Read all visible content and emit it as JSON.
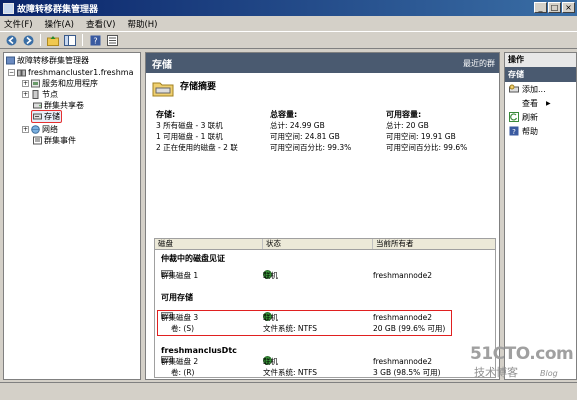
{
  "window": {
    "title": "故障转移群集管理器"
  },
  "menu": [
    "文件(F)",
    "操作(A)",
    "查看(V)",
    "帮助(H)"
  ],
  "tree": {
    "root": "故障转移群集管理器",
    "cluster": "freshmancluster1.freshma",
    "items": [
      "服务和应用程序",
      "节点",
      "群集共享卷",
      "存储",
      "网络",
      "群集事件"
    ]
  },
  "center": {
    "header": "存储",
    "recent": "最近的群",
    "summary_title": "存储摘要",
    "storage_col": {
      "heading": "存储:",
      "lines": [
        "3 所有磁盘 - 3 联机",
        "1 可用磁盘 - 1 联机",
        "2 正在使用的磁盘 - 2 联"
      ]
    },
    "total_col": {
      "heading": "总容量:",
      "lines": [
        "总计: 24.99 GB",
        "可用空间: 24.81 GB",
        "可用空间百分比: 99.3%"
      ]
    },
    "avail_col": {
      "heading": "可用容量:",
      "lines": [
        "总计: 20 GB",
        "可用空间: 19.91 GB",
        "可用空间百分比: 99.6%"
      ]
    },
    "columns": [
      "磁盘",
      "状态",
      "当前所有者"
    ],
    "groups": [
      {
        "name": "仲裁中的磁盘见证",
        "disk": "群集磁盘 1",
        "status": "联机",
        "owner": "freshmannode2"
      },
      {
        "name": "可用存储",
        "disk": "群集磁盘 3",
        "status": "联机",
        "owner": "freshmannode2",
        "sub_label": "卷: (S)",
        "sub_fs": "文件系统: NTFS",
        "sub_size": "20 GB (99.6% 可用)"
      },
      {
        "name": "freshmanclusDtc",
        "disk": "群集磁盘 2",
        "status": "联机",
        "owner": "freshmannode2",
        "sub_label": "卷: (R)",
        "sub_fs": "文件系统: NTFS",
        "sub_size": "3 GB (98.5% 可用)"
      }
    ]
  },
  "actions": {
    "top": "操作",
    "header": "存储",
    "items": [
      "添加...",
      "查看",
      "刷新",
      "帮助"
    ]
  },
  "watermark": {
    "brand": "51CTO.com",
    "sub": "技术博客",
    "blog": "Blog"
  }
}
